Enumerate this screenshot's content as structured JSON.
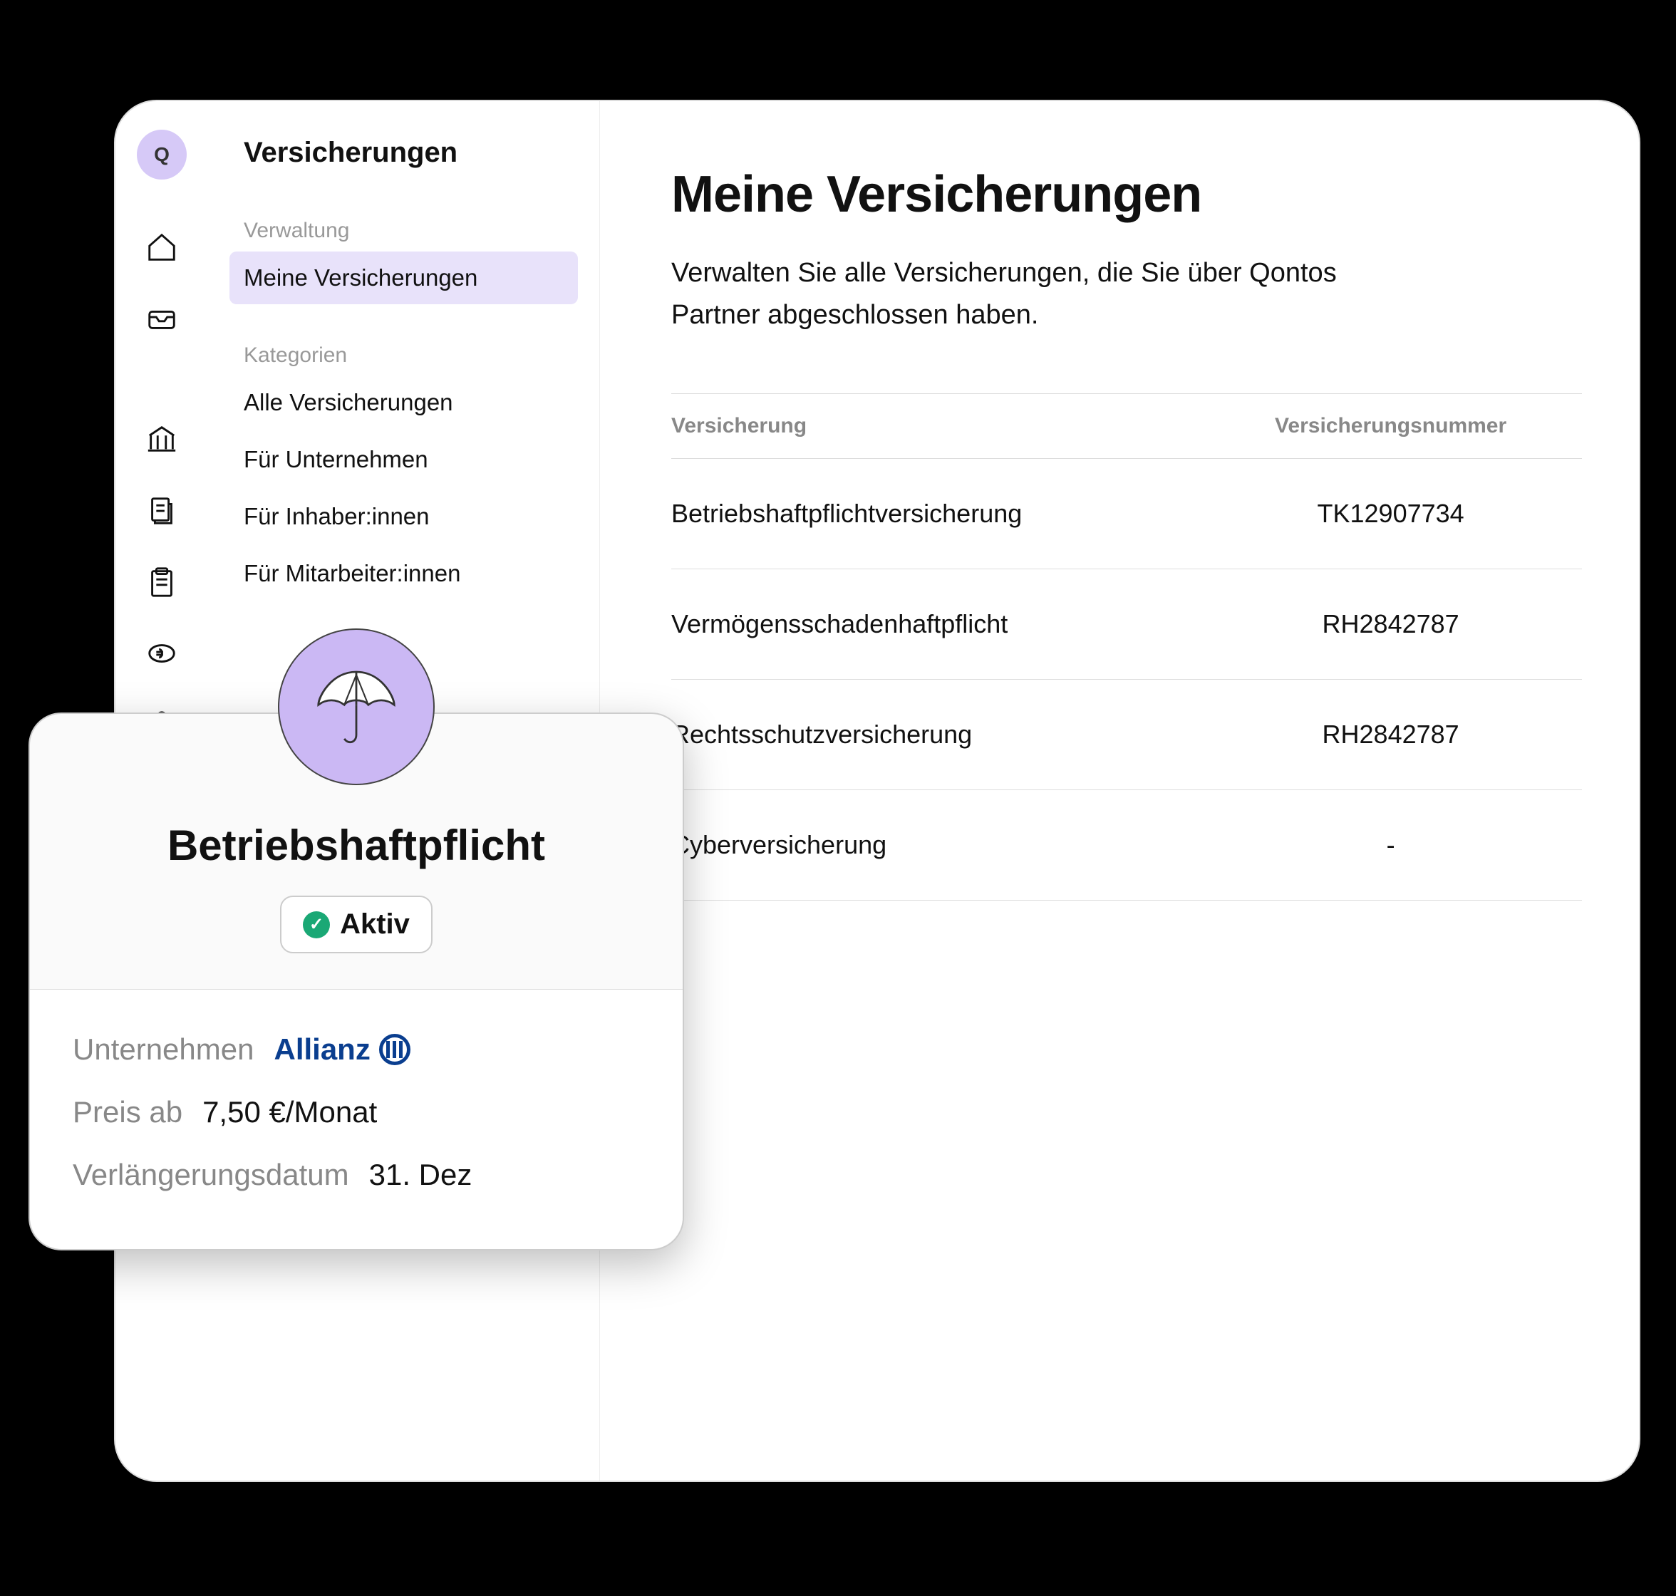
{
  "rail": {
    "logo_letter": "Q"
  },
  "sidebar": {
    "title": "Versicherungen",
    "group1_label": "Verwaltung",
    "group2_label": "Kategorien",
    "items1": {
      "0": {
        "label": "Meine Versicherungen"
      }
    },
    "items2": {
      "0": {
        "label": "Alle Versicherungen"
      },
      "1": {
        "label": "Für Unternehmen"
      },
      "2": {
        "label": "Für Inhaber:innen"
      },
      "3": {
        "label": "Für Mitarbeiter:innen"
      }
    }
  },
  "main": {
    "title": "Meine Versicherungen",
    "subtitle": "Verwalten Sie alle Versicherungen, die Sie über Qontos Partner abgeschlossen haben.",
    "col_name": "Versicherung",
    "col_num": "Versicherungsnummer",
    "rows": {
      "0": {
        "name": "Betriebshaftpflichtversicherung",
        "num": "TK12907734"
      },
      "1": {
        "name": "Vermögensschadenhaftpflicht",
        "num": "RH2842787"
      },
      "2": {
        "name": "Rechtsschutzversicherung",
        "num": "RH2842787"
      },
      "3": {
        "name": "Cyberversicherung",
        "num": "-"
      }
    }
  },
  "card": {
    "title": "Betriebshaftpflicht",
    "status": "Aktiv",
    "company_label": "Unternehmen",
    "company_name": "Allianz",
    "price_label": "Preis ab",
    "price_value": "7,50 €/Monat",
    "renew_label": "Verlängerungsdatum",
    "renew_value": "31. Dez"
  }
}
